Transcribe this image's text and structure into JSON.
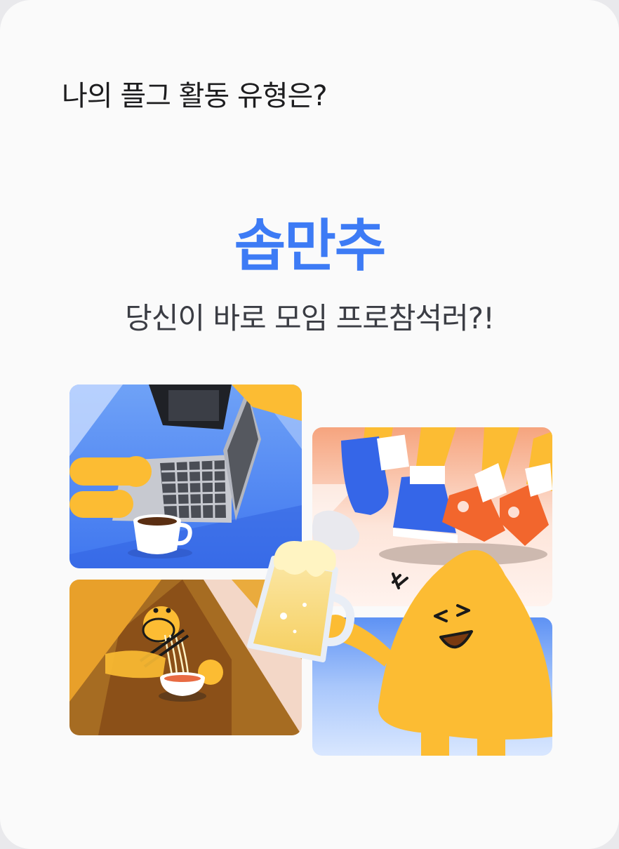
{
  "header": {
    "question": "나의 플그 활동 유형은?"
  },
  "result": {
    "type_name": "솝만추",
    "description": "당신이 바로 모임 프로참석러?!"
  },
  "illustration": {
    "panels": [
      "laptop-scene",
      "running-shoes-scene",
      "noodle-eating-scene",
      "beer-cheers-scene"
    ],
    "colors": {
      "accent": "#3d7bf5",
      "character": "#fcbc33",
      "shoe_blue": "#3566e8",
      "shoe_orange": "#f2662d"
    }
  }
}
